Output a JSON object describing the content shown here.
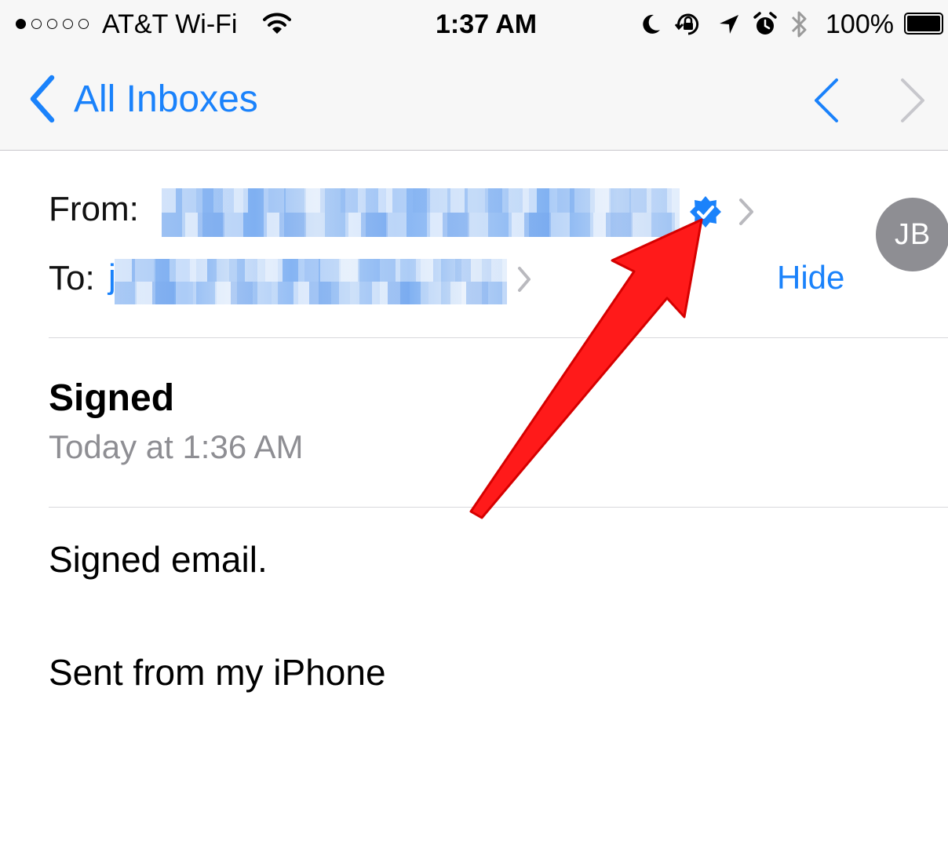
{
  "status_bar": {
    "carrier": "AT&T Wi-Fi",
    "time": "1:37 AM",
    "battery_percent": "100%",
    "signal_bars_filled": 1,
    "signal_bars_total": 5,
    "icons": [
      "wifi-icon",
      "moon-icon",
      "orientation-lock-icon",
      "location-arrow-icon",
      "alarm-icon",
      "bluetooth-icon",
      "battery-icon"
    ]
  },
  "nav": {
    "back_label": "All Inboxes",
    "icons": [
      "back-chevron-icon",
      "previous-message-icon",
      "next-message-icon"
    ]
  },
  "header": {
    "from_label": "From:",
    "to_label": "To:",
    "to_visible_prefix": "j",
    "hide_label": "Hide",
    "avatar_initials": "JB",
    "verified_badge_icon": "verified-badge-icon"
  },
  "message": {
    "subject": "Signed",
    "date": "Today at 1:36 AM",
    "body_lines": [
      "Signed email.",
      "Sent from my iPhone"
    ]
  },
  "annotation": {
    "icon": "red-arrow-icon"
  },
  "colors": {
    "accent": "#1a82fb",
    "annotation": "#ff1a1a",
    "avatar": "#8e8e93",
    "secondary_text": "#8e8e93"
  }
}
